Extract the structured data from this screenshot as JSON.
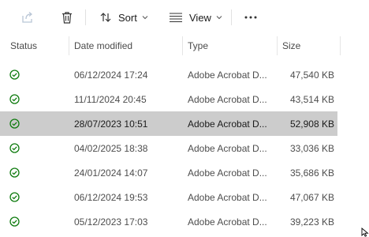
{
  "toolbar": {
    "share_icon": "share-icon",
    "delete_icon": "trash-icon",
    "sort_label": "Sort",
    "view_label": "View",
    "more_icon": "ellipsis-icon"
  },
  "columns": {
    "status": "Status",
    "date_modified": "Date modified",
    "type": "Type",
    "size": "Size"
  },
  "rows": [
    {
      "status": "synced",
      "date": "06/12/2024 17:24",
      "type": "Adobe Acrobat D...",
      "size": "47,540 KB",
      "selected": false
    },
    {
      "status": "synced",
      "date": "11/11/2024 20:45",
      "type": "Adobe Acrobat D...",
      "size": "43,514 KB",
      "selected": false
    },
    {
      "status": "synced",
      "date": "28/07/2023 10:51",
      "type": "Adobe Acrobat D...",
      "size": "52,908 KB",
      "selected": true
    },
    {
      "status": "synced",
      "date": "04/02/2025 18:38",
      "type": "Adobe Acrobat D...",
      "size": "33,036 KB",
      "selected": false
    },
    {
      "status": "synced",
      "date": "24/01/2024 14:07",
      "type": "Adobe Acrobat D...",
      "size": "35,686 KB",
      "selected": false
    },
    {
      "status": "synced",
      "date": "06/12/2024 19:53",
      "type": "Adobe Acrobat D...",
      "size": "47,067 KB",
      "selected": false
    },
    {
      "status": "synced",
      "date": "05/12/2023 17:03",
      "type": "Adobe Acrobat D...",
      "size": "39,223 KB",
      "selected": false
    }
  ],
  "colors": {
    "status_green": "#107c10",
    "selected_bg": "#cccccc"
  }
}
